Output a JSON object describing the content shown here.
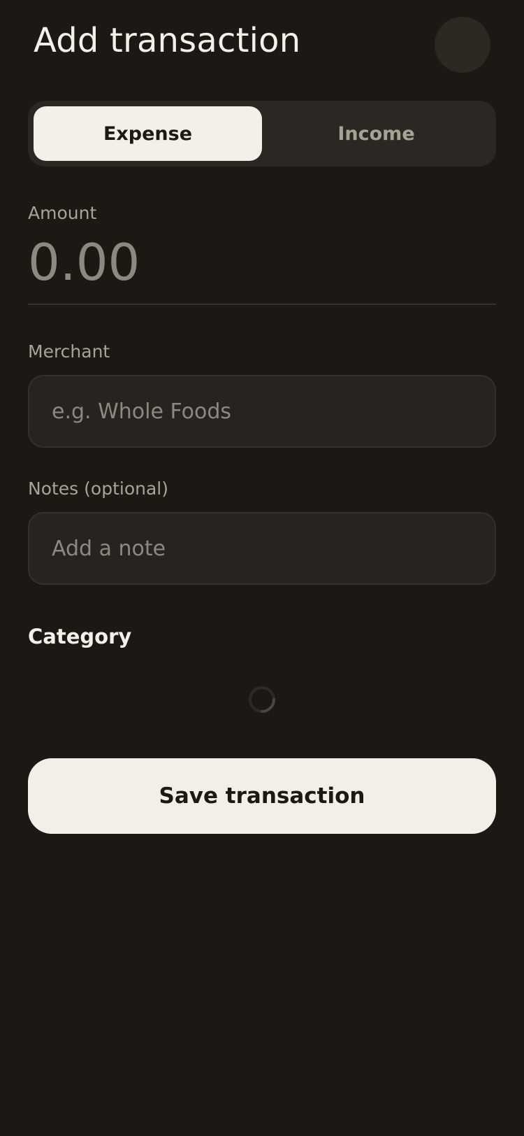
{
  "header": {
    "title": "Add transaction"
  },
  "type_toggle": {
    "options": [
      {
        "label": "Expense",
        "selected": true
      },
      {
        "label": "Income",
        "selected": false
      }
    ]
  },
  "amount": {
    "label": "Amount",
    "placeholder": "0.00",
    "value": ""
  },
  "merchant": {
    "label": "Merchant",
    "placeholder": "e.g. Whole Foods",
    "value": ""
  },
  "notes": {
    "label": "Notes (optional)",
    "placeholder": "Add a note",
    "value": ""
  },
  "category": {
    "heading": "Category",
    "loading": true
  },
  "actions": {
    "save_label": "Save transaction"
  },
  "colors": {
    "background": "#1c1915",
    "surface": "#2b2722",
    "input_surface": "#262320",
    "accent_light": "#f4f0e9",
    "muted_text": "#a9a397"
  },
  "icons": {
    "loading": "loading-spinner-icon",
    "avatar": "avatar"
  }
}
